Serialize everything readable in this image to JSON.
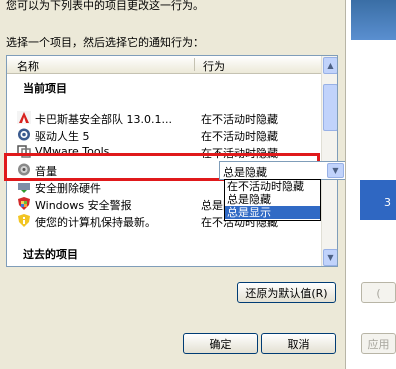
{
  "intro_text": "您可以为下列表中的项目更改这一行为。",
  "instruction": "选择一个项目，然后选择它的通知行为：",
  "columns": {
    "name": "名称",
    "behavior": "行为"
  },
  "sections": {
    "current": "当前项目",
    "past": "过去的项目"
  },
  "rows": [
    {
      "icon": "kaspersky-icon",
      "name": "卡巴斯基安全部队 13.0.1...",
      "behavior": "在不活动时隐藏"
    },
    {
      "icon": "driver-gear-icon",
      "name": "驱动人生 5",
      "behavior": "在不活动时隐藏"
    },
    {
      "icon": "vmware-icon",
      "name": "VMware Tools",
      "behavior": "在不活动时隐藏"
    },
    {
      "icon": "speaker-icon",
      "name": "音量",
      "behavior": "总是隐藏"
    },
    {
      "icon": "safely-remove-hardware-icon",
      "name": "安全删除硬件",
      "behavior": "在不活动时隐藏"
    },
    {
      "icon": "windows-security-shield-icon",
      "name": "Windows 安全警报",
      "behavior": "总是隐藏"
    },
    {
      "icon": "info-icon",
      "name": "使您的计算机保持最新。",
      "behavior": "在不活动时隐藏"
    }
  ],
  "combo": {
    "value": "总是隐藏"
  },
  "dropdown_options": [
    "在不活动时隐藏",
    "总是隐藏",
    "总是显示"
  ],
  "dropdown_selected_index": 2,
  "buttons": {
    "restore": "还原为默认值(R)",
    "ok": "确定",
    "cancel": "取消"
  },
  "right_panel": {
    "num": "3",
    "btn1": "(",
    "btn2": "应用"
  },
  "colors": {
    "highlight": "#e0191b",
    "selection": "#316ac5"
  }
}
